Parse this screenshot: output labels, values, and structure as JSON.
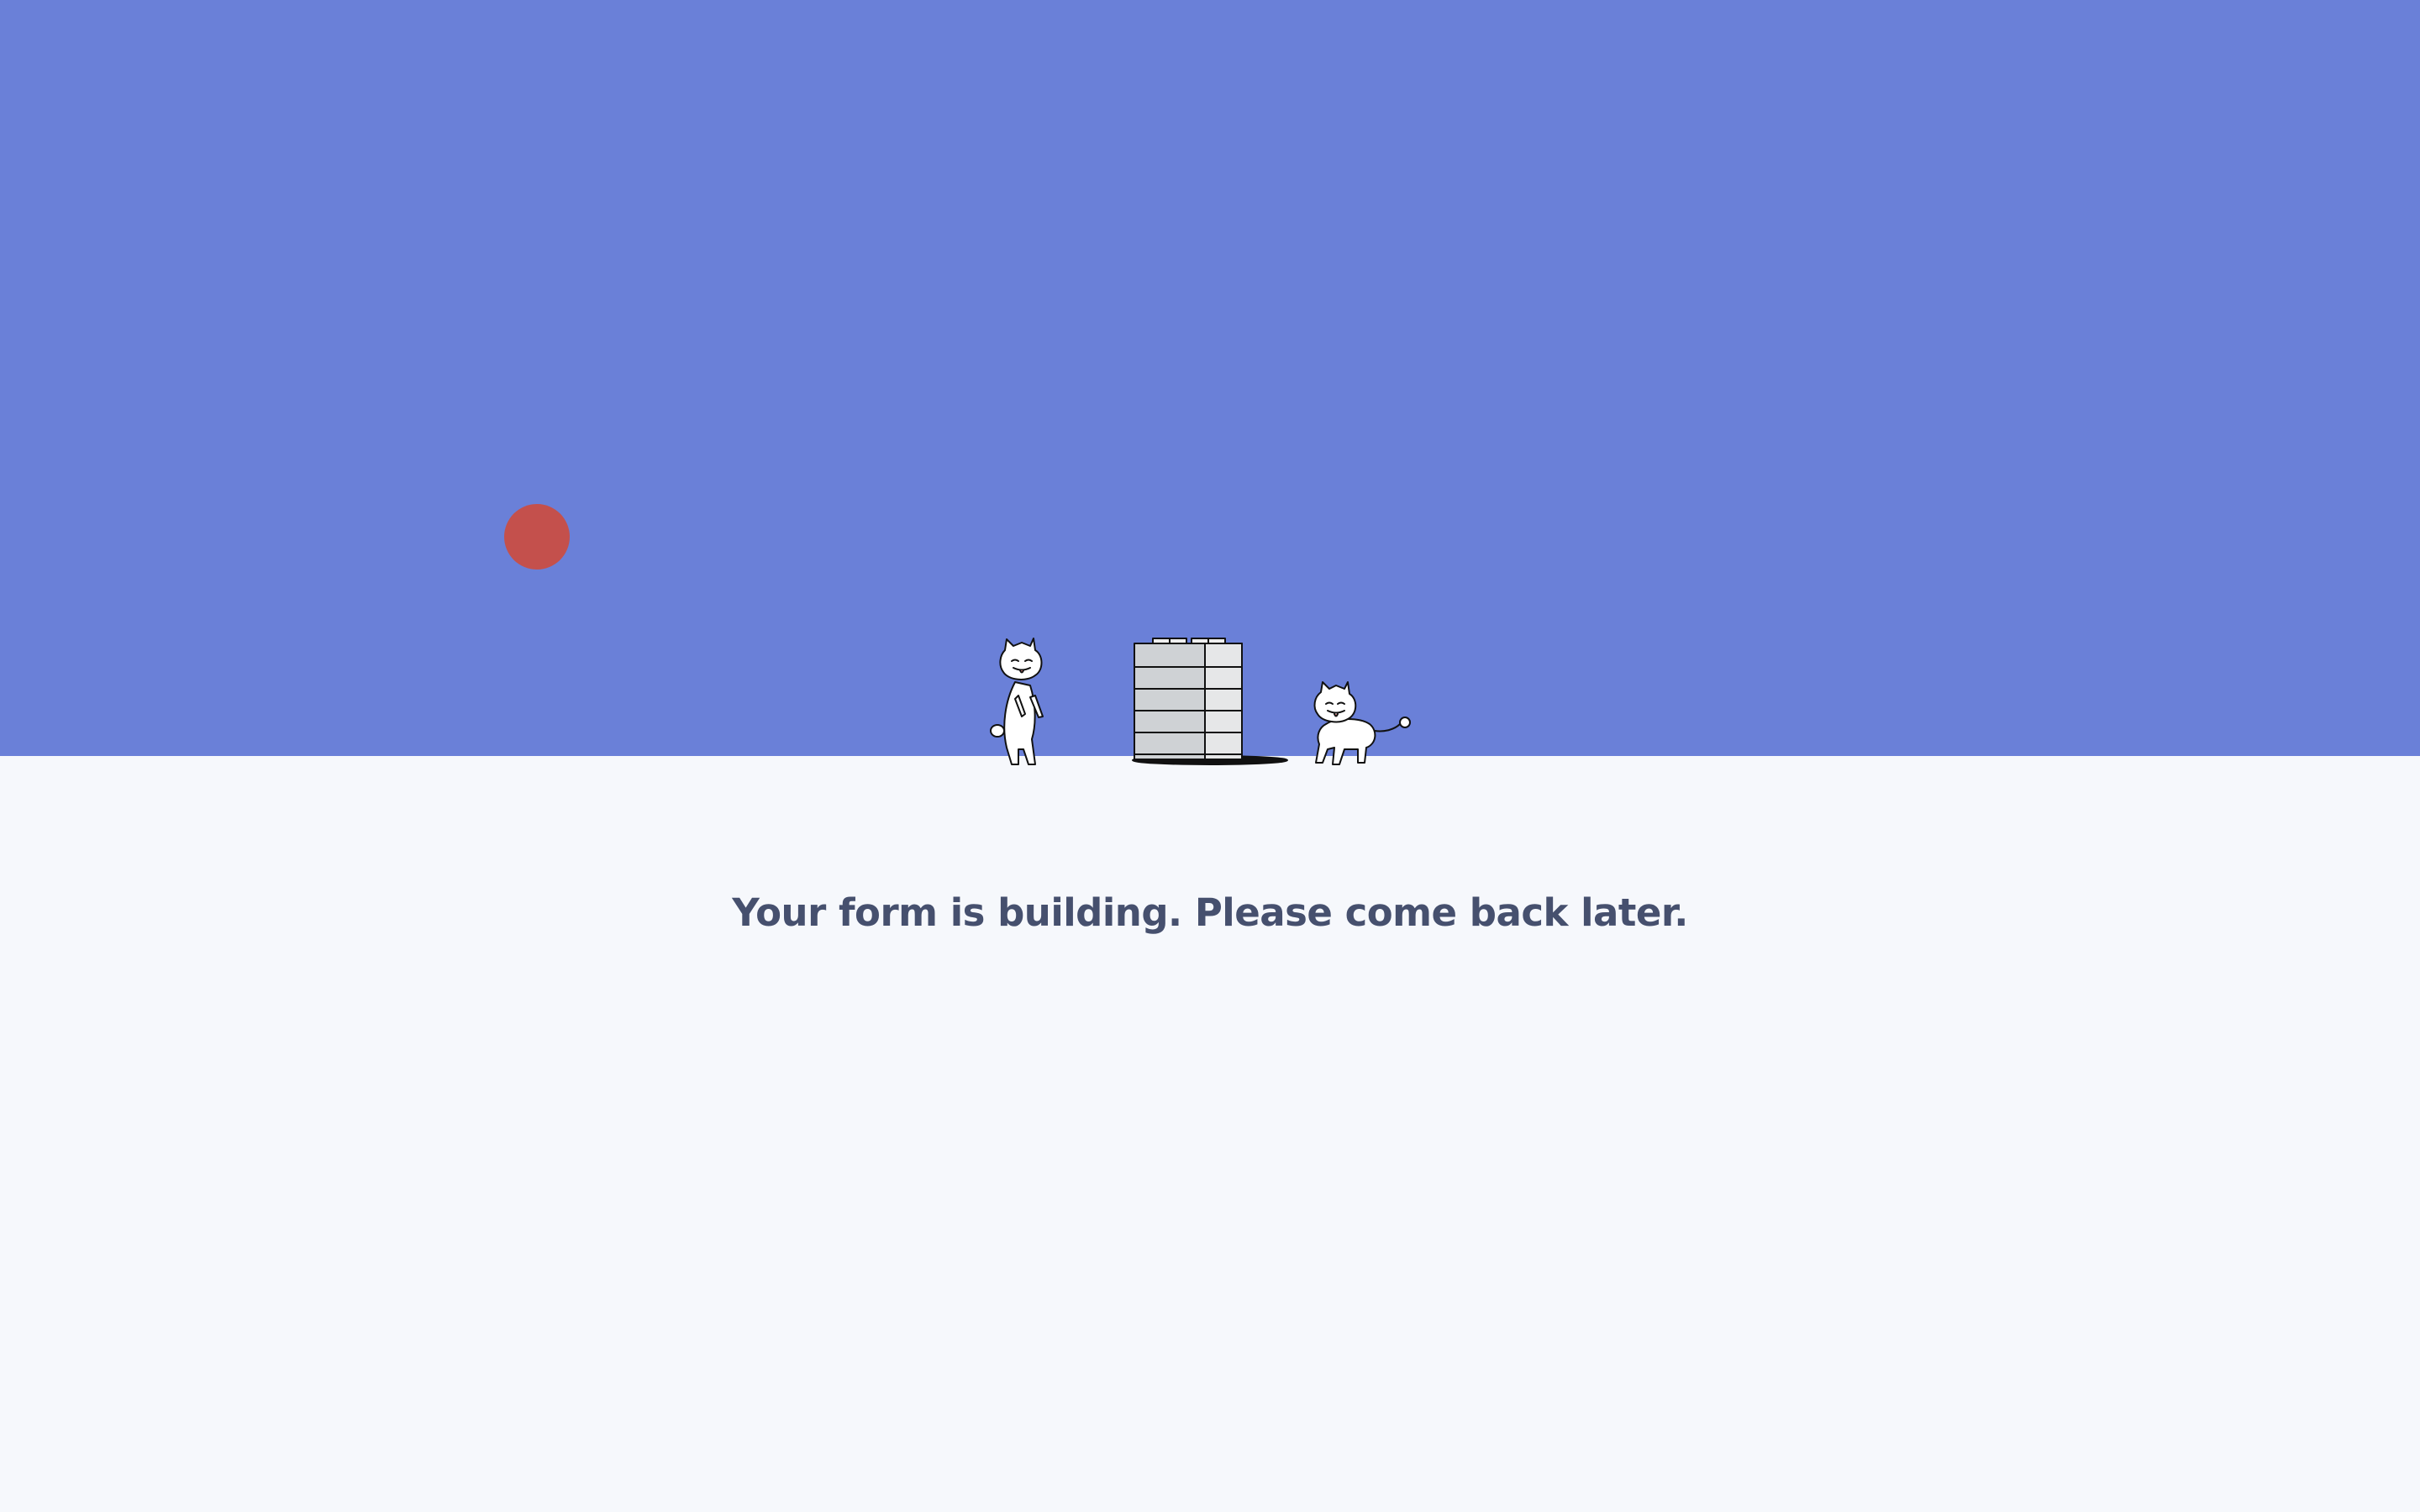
{
  "colors": {
    "hero_background": "#6a80d8",
    "page_background": "#f6f8fc",
    "sun": "#c4504c",
    "message_text": "#46506e"
  },
  "illustration": {
    "icons": [
      "standing-cat-icon",
      "building-icon",
      "crawling-cat-icon",
      "sun-circle-icon"
    ]
  },
  "message": "Your form is building. Please come back later."
}
